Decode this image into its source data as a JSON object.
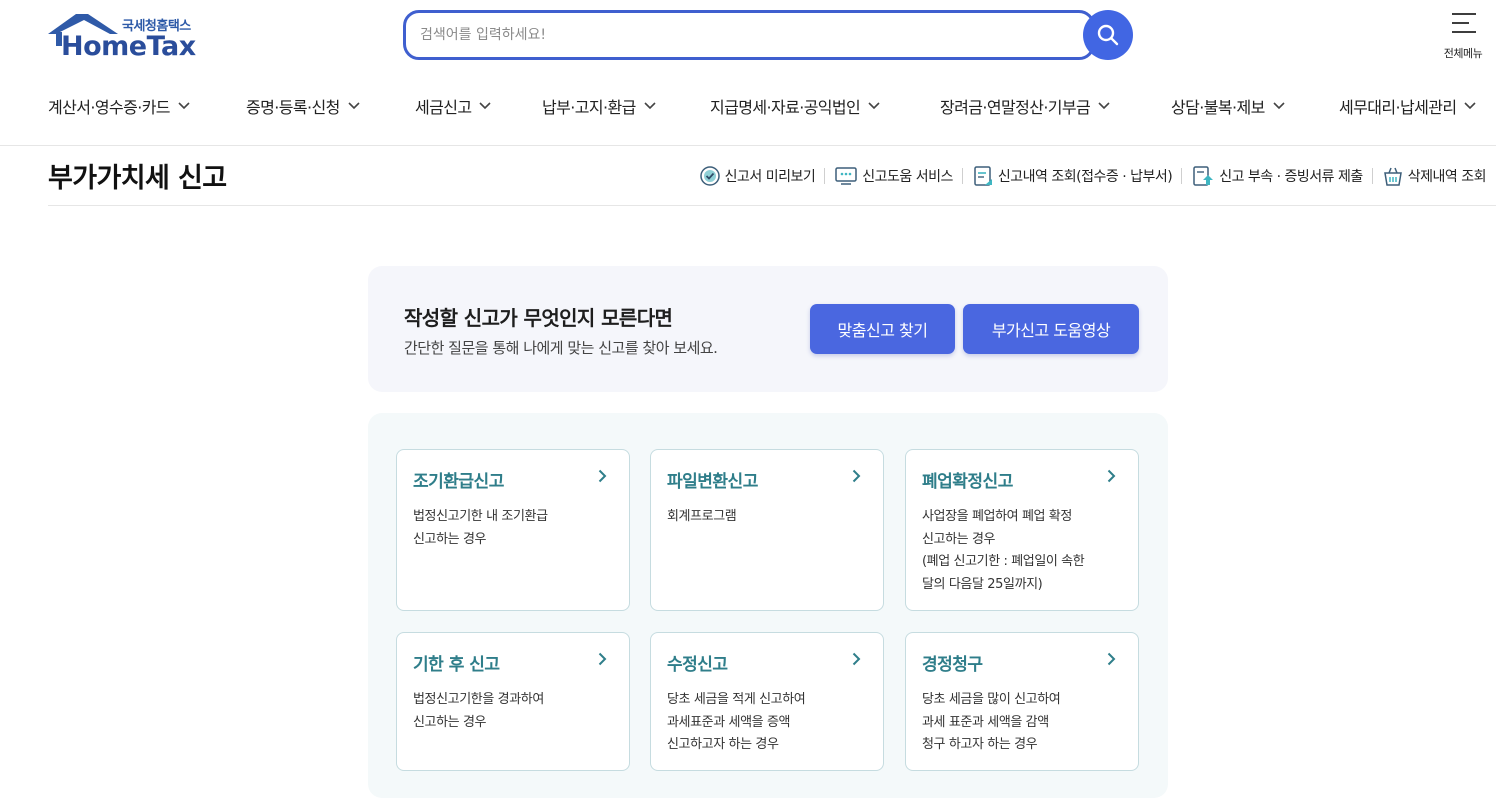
{
  "header": {
    "logo_kr": "국세청홈택스",
    "logo_en": "HomeTax",
    "search_placeholder": "검색어를 입력하세요!",
    "all_menu_label": "전체메뉴"
  },
  "gnb": [
    "계산서·영수증·카드",
    "증명·등록·신청",
    "세금신고",
    "납부·고지·환급",
    "지급명세·자료·공익법인",
    "장려금·연말정산·기부금",
    "상담·불복·제보",
    "세무대리·납세관리"
  ],
  "page": {
    "title": "부가가치세 신고",
    "utils": [
      "신고서 미리보기",
      "신고도움 서비스",
      "신고내역 조회(접수증 · 납부서)",
      "신고 부속 · 증빙서류 제출",
      "삭제내역 조회"
    ]
  },
  "helper": {
    "title": "작성할 신고가 무엇인지 모른다면",
    "subtitle": "간단한 질문을 통해 나에게 맞는 신고를 찾아 보세요.",
    "btn_find": "맞춤신고 찾기",
    "btn_video": "부가신고 도움영상"
  },
  "cards": [
    {
      "title": "조기환급신고",
      "desc": "법정신고기한 내 조기환급\n신고하는 경우"
    },
    {
      "title": "파일변환신고",
      "desc": "회계프로그램"
    },
    {
      "title": "폐업확정신고",
      "desc": "사업장을 폐업하여 폐업 확정\n신고하는 경우\n(폐업 신고기한 : 폐업일이 속한\n달의 다음달 25일까지)"
    },
    {
      "title": "기한 후 신고",
      "desc": "법정신고기한을 경과하여\n신고하는 경우"
    },
    {
      "title": "수정신고",
      "desc": "당초 세금을 적게 신고하여\n과세표준과 세액을 증액\n신고하고자 하는 경우"
    },
    {
      "title": "경정청구",
      "desc": "당초 세금을 많이 신고하여\n과세 표준과 세액을 감액\n청구 하고자 하는 경우"
    }
  ],
  "colors": {
    "brand_blue": "#4166e3",
    "button_blue": "#4a67e0",
    "card_title_teal": "#2f7e8a",
    "logo_navy": "#2a4d9b"
  },
  "icons": {
    "search": "search-icon",
    "menu": "hamburger-icon",
    "chevron": "chevron-down-icon",
    "arrow": "chevron-right-icon"
  }
}
